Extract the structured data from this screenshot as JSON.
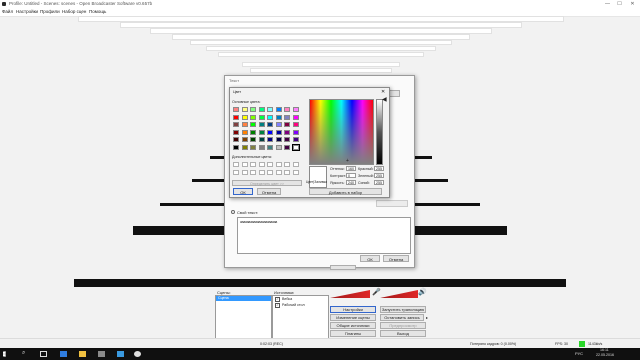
{
  "window": {
    "title": "Profile: Untitled - Scenes: scenes - Open Broadcaster Software v0.657b",
    "minimize": "—",
    "maximize": "☐",
    "close": "✕"
  },
  "menu": [
    "Файл",
    "Настройки",
    "Профили",
    "Набор сцен",
    "Помощь"
  ],
  "text_dialog": {
    "title": "Текст",
    "own_text_label": "Свой текст:",
    "text_value": "aaaaaaaaaaaaaaaaaaaaaa",
    "ok_label": "ОК",
    "cancel_label": "Отмена"
  },
  "color_picker": {
    "title": "Цвет",
    "basic_colors_label": "Основные цвета:",
    "custom_colors_label": "Дополнительные цвета:",
    "define_custom_label": "Определить цвет >>",
    "ok_label": "ОК",
    "cancel_label": "Отмена",
    "add_label": "Добавить в набор",
    "color_solid_label": "Цвет|Заливка",
    "hue_label": "Оттенок:",
    "hue_value": "160",
    "sat_label": "Контраст:",
    "sat_value": "0",
    "lum_label": "Яркость:",
    "lum_value": "240",
    "red_label": "Красный:",
    "red_value": "255",
    "green_label": "Зеленый:",
    "green_value": "255",
    "blue_label": "Синий:",
    "blue_value": "255",
    "basic_colors": [
      "#ff8080",
      "#ffff80",
      "#80ff80",
      "#00ff80",
      "#80ffff",
      "#0080ff",
      "#ff80c0",
      "#ff80ff",
      "#ff0000",
      "#ffff00",
      "#80ff00",
      "#00ff40",
      "#00ffff",
      "#0080c0",
      "#8080c0",
      "#ff00ff",
      "#804040",
      "#ff8040",
      "#00ff00",
      "#008080",
      "#004080",
      "#8080ff",
      "#800040",
      "#ff0080",
      "#800000",
      "#ff8000",
      "#008000",
      "#008040",
      "#0000ff",
      "#0000a0",
      "#800080",
      "#8000ff",
      "#400000",
      "#804000",
      "#004000",
      "#004040",
      "#000080",
      "#000040",
      "#400040",
      "#400080",
      "#000000",
      "#808000",
      "#808040",
      "#808080",
      "#408080",
      "#c0c0c0",
      "#400040",
      "#ffffff"
    ]
  },
  "scenes": {
    "label": "Сцены:",
    "items": [
      "Сцена"
    ]
  },
  "sources": {
    "label": "Источники:",
    "items": [
      "Вебка",
      "Рабочий стол"
    ]
  },
  "controls": {
    "settings": "Настройки",
    "start_stream": "Запустить трансляцию",
    "edit_scene": "Изменение сцены",
    "start_record": "Остановить запись",
    "global_sources": "Общие источники",
    "preview": "Предпросмотр",
    "plugins": "Плагины",
    "exit": "Выход"
  },
  "status": {
    "time": "0:02:03 (REC)",
    "dropped": "Потеряно кадров: 0 (0.00%)",
    "fps": "FPS: 30",
    "kbps": "1143kb/s"
  },
  "taskbar": {
    "lang": "РУС",
    "clock_time": "16:11",
    "clock_date": "22.05.2016"
  },
  "colors": {
    "accent_green": "#29d629",
    "meter_red": "#c81e1e",
    "select_blue": "#3399ff"
  }
}
